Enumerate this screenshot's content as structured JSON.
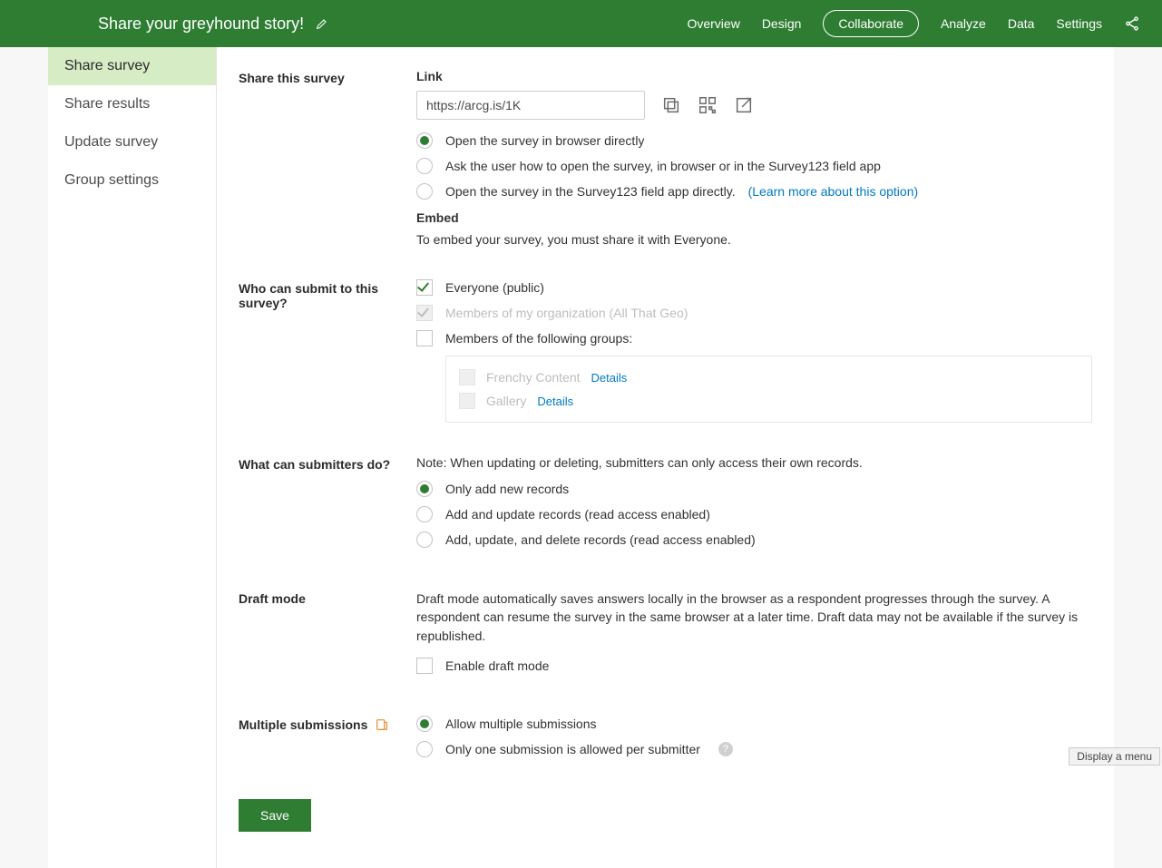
{
  "header": {
    "title": "Share your greyhound story!",
    "nav": {
      "overview": "Overview",
      "design": "Design",
      "collaborate": "Collaborate",
      "analyze": "Analyze",
      "data": "Data",
      "settings": "Settings"
    }
  },
  "sidebar": {
    "share_survey": "Share survey",
    "share_results": "Share results",
    "update_survey": "Update survey",
    "group_settings": "Group settings"
  },
  "share": {
    "heading": "Share this survey",
    "link_label": "Link",
    "link_value": "https://arcg.is/1K",
    "radio1": "Open the survey in browser directly",
    "radio2": "Ask the user how to open the survey, in browser or in the Survey123 field app",
    "radio3": "Open the survey in the Survey123 field app directly.",
    "learn_more": "(Learn more about this option)",
    "embed_label": "Embed",
    "embed_text": "To embed your survey, you must share it with Everyone."
  },
  "submit": {
    "heading": "Who can submit to this survey?",
    "everyone": "Everyone (public)",
    "org": "Members of my organization (All That Geo)",
    "groups": "Members of the following groups:",
    "group1": "Frenchy Content",
    "group2": "Gallery",
    "details": "Details"
  },
  "permissions": {
    "heading": "What can submitters do?",
    "note": "Note: When updating or deleting, submitters can only access their own records.",
    "opt1": "Only add new records",
    "opt2": "Add and update records (read access enabled)",
    "opt3": "Add, update, and delete records (read access enabled)"
  },
  "draft": {
    "heading": "Draft mode",
    "desc": "Draft mode automatically saves answers locally in the browser as a respondent progresses through the survey. A respondent can resume the survey in the same browser at a later time. Draft data may not be available if the survey is republished.",
    "enable": "Enable draft mode"
  },
  "multiple": {
    "heading": "Multiple submissions",
    "opt1": "Allow multiple submissions",
    "opt2": "Only one submission is allowed per submitter"
  },
  "save": "Save",
  "footer_hint": "Display a menu"
}
